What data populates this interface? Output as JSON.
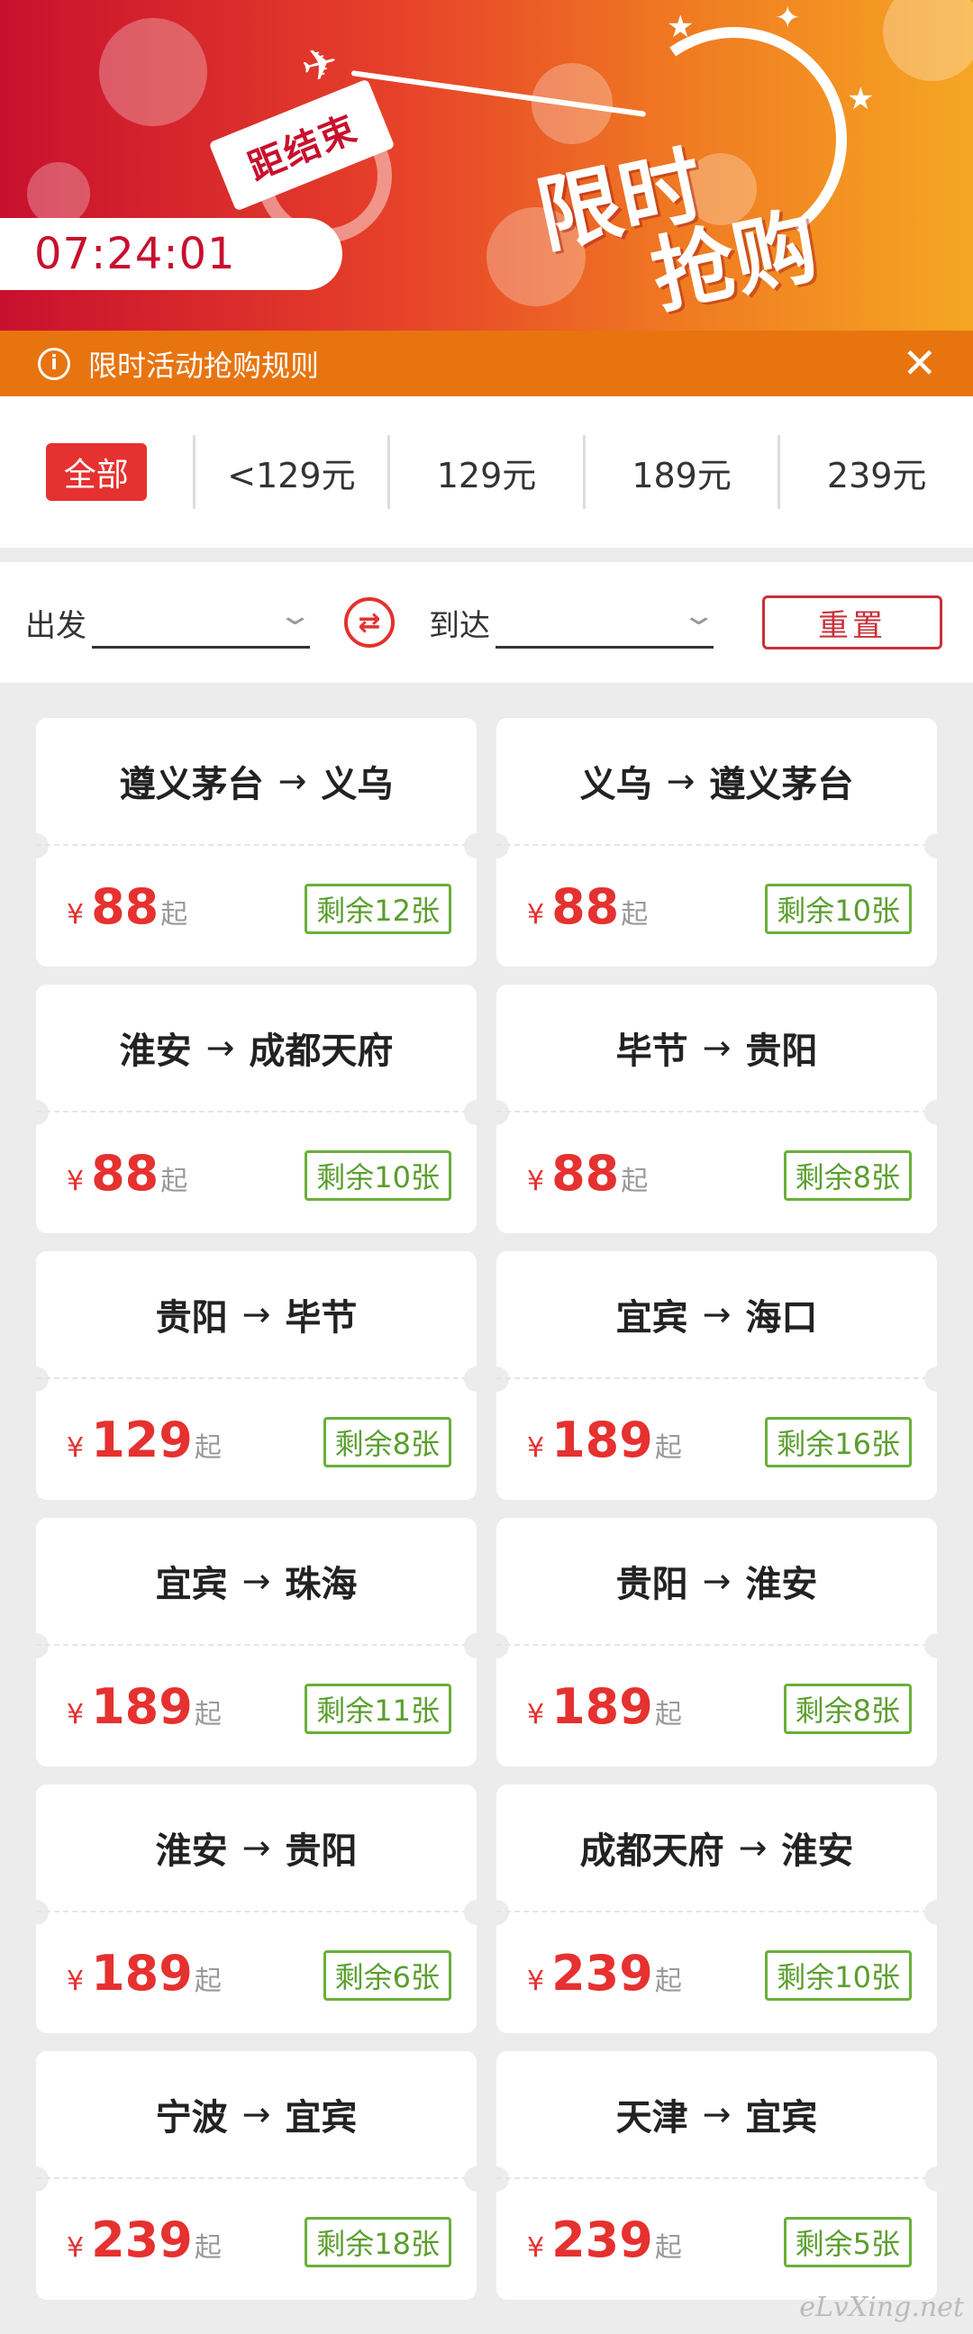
{
  "banner": {
    "countdown_label": "距结束",
    "countdown_time": "07:24:01",
    "title_line1": "限时",
    "title_line2": "抢购"
  },
  "rules_bar": {
    "text": "限时活动抢购规则"
  },
  "price_filter": [
    {
      "label": "全部",
      "active": true
    },
    {
      "label": "<129元"
    },
    {
      "label": "129元"
    },
    {
      "label": "189元"
    },
    {
      "label": "239元"
    }
  ],
  "search": {
    "depart_label": "出发",
    "arrive_label": "到达",
    "reset_label": "重置"
  },
  "tickets": [
    {
      "from": "遵义茅台",
      "to": "义乌",
      "currency": "¥",
      "price": "88",
      "suffix": "起",
      "remaining": "剩余12张"
    },
    {
      "from": "义乌",
      "to": "遵义茅台",
      "currency": "¥",
      "price": "88",
      "suffix": "起",
      "remaining": "剩余10张"
    },
    {
      "from": "淮安",
      "to": "成都天府",
      "currency": "¥",
      "price": "88",
      "suffix": "起",
      "remaining": "剩余10张"
    },
    {
      "from": "毕节",
      "to": "贵阳",
      "currency": "¥",
      "price": "88",
      "suffix": "起",
      "remaining": "剩余8张"
    },
    {
      "from": "贵阳",
      "to": "毕节",
      "currency": "¥",
      "price": "129",
      "suffix": "起",
      "remaining": "剩余8张"
    },
    {
      "from": "宜宾",
      "to": "海口",
      "currency": "¥",
      "price": "189",
      "suffix": "起",
      "remaining": "剩余16张"
    },
    {
      "from": "宜宾",
      "to": "珠海",
      "currency": "¥",
      "price": "189",
      "suffix": "起",
      "remaining": "剩余11张"
    },
    {
      "from": "贵阳",
      "to": "淮安",
      "currency": "¥",
      "price": "189",
      "suffix": "起",
      "remaining": "剩余8张"
    },
    {
      "from": "淮安",
      "to": "贵阳",
      "currency": "¥",
      "price": "189",
      "suffix": "起",
      "remaining": "剩余6张"
    },
    {
      "from": "成都天府",
      "to": "淮安",
      "currency": "¥",
      "price": "239",
      "suffix": "起",
      "remaining": "剩余10张"
    },
    {
      "from": "宁波",
      "to": "宜宾",
      "currency": "¥",
      "price": "239",
      "suffix": "起",
      "remaining": "剩余18张"
    },
    {
      "from": "天津",
      "to": "宜宾",
      "currency": "¥",
      "price": "239",
      "suffix": "起",
      "remaining": "剩余5张"
    }
  ],
  "watermark": "eLvXing.net",
  "colors": {
    "accent_red": "#e5312f",
    "rules_orange": "#e8740f",
    "badge_green": "#6aaf3a"
  }
}
